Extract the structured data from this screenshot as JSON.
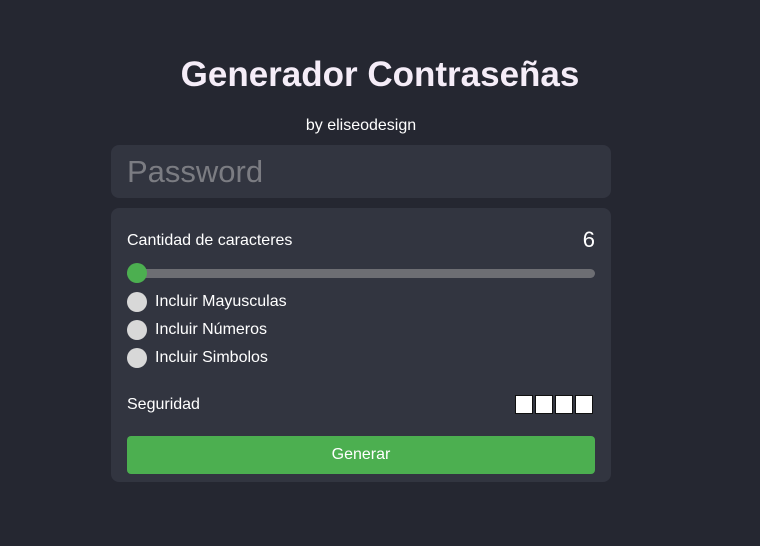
{
  "header": {
    "title": "Generador Contraseñas",
    "byline": "by eliseodesign"
  },
  "password": {
    "placeholder": "Password",
    "value": ""
  },
  "length": {
    "label": "Cantidad de caracteres",
    "value": "6",
    "slider_fraction": 0.0
  },
  "options": [
    {
      "label": "Incluir Mayusculas",
      "checked": false
    },
    {
      "label": "Incluir Números",
      "checked": false
    },
    {
      "label": "Incluir Simbolos",
      "checked": false
    }
  ],
  "security": {
    "label": "Seguridad",
    "level": 0,
    "max_level": 4
  },
  "actions": {
    "generate_label": "Generar"
  },
  "colors": {
    "background": "#252731",
    "panel": "#323540",
    "accent": "#4caf50",
    "track": "#6d6e73",
    "option_dot": "#d8d8d8"
  }
}
